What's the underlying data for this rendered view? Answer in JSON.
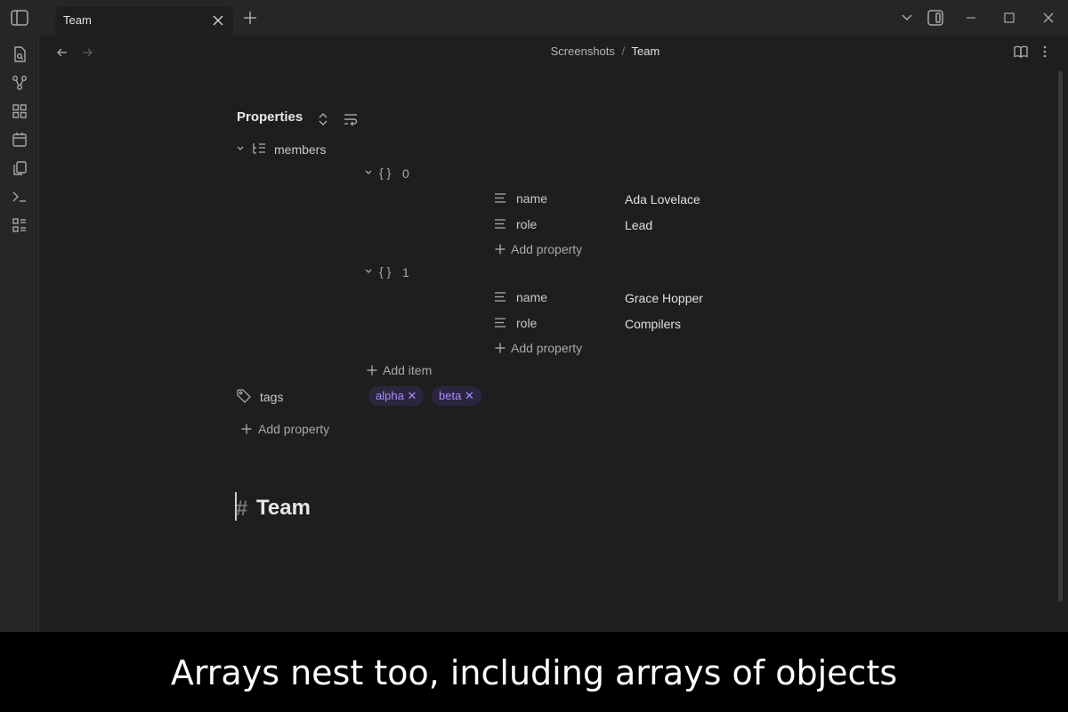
{
  "tab": {
    "title": "Team"
  },
  "breadcrumb": {
    "folder": "Screenshots",
    "separator": "/",
    "current": "Team"
  },
  "properties": {
    "heading": "Properties",
    "members": {
      "label": "members",
      "items": [
        {
          "index": "0",
          "fields": [
            {
              "key": "name",
              "value": "Ada Lovelace"
            },
            {
              "key": "role",
              "value": "Lead"
            }
          ],
          "add_label": "Add property"
        },
        {
          "index": "1",
          "fields": [
            {
              "key": "name",
              "value": "Grace Hopper"
            },
            {
              "key": "role",
              "value": "Compilers"
            }
          ],
          "add_label": "Add property"
        }
      ],
      "add_item_label": "Add item",
      "object_glyph": "{ }"
    },
    "tags": {
      "label": "tags",
      "values": [
        "alpha",
        "beta"
      ]
    },
    "add_property_label": "Add property"
  },
  "note": {
    "hash": "#",
    "title": "Team"
  },
  "caption": "Arrays nest too, including arrays of objects",
  "colors": {
    "accent": "#a88bfa",
    "tag_bg": "#2b2640",
    "background": "#1e1e1e",
    "chrome": "#262626"
  }
}
